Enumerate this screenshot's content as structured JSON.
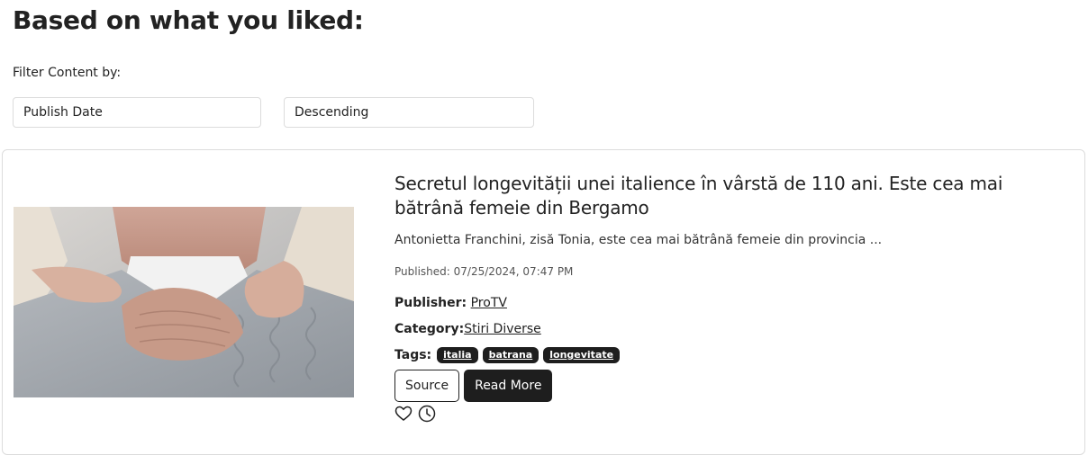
{
  "page": {
    "heading": "Based on what you liked:"
  },
  "filters": {
    "label": "Filter Content by:",
    "sort_field": "Publish Date",
    "sort_order": "Descending"
  },
  "article": {
    "title": "Secretul longevității unei italience în vârstă de 110 ani. Este cea mai bătrână femeie din Bergamo",
    "excerpt": "Antonietta Franchini, zisă Tonia, este cea mai bătrână femeie din provincia ...",
    "published": "Published: 07/25/2024, 07:47 PM",
    "publisher_label": "Publisher:",
    "publisher": "ProTV",
    "category_label": "Category:",
    "category": "Stiri Diverse",
    "tags_label": "Tags:",
    "tags": [
      "italia",
      "batrana",
      "longevitate"
    ],
    "source_label": "Source",
    "read_more_label": "Read More",
    "icons": [
      "heart-icon",
      "clock-icon"
    ]
  }
}
